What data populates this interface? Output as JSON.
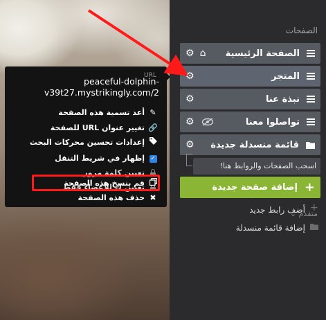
{
  "section_title": "الصفحات",
  "pages": [
    {
      "label": "الصفحة الرئيسية",
      "home": true,
      "hidden": false
    },
    {
      "label": "المتجر",
      "home": false,
      "hidden": false,
      "active": true
    },
    {
      "label": "نبذة عنا",
      "home": false,
      "hidden": false
    },
    {
      "label": "تواصلوا معنا",
      "home": false,
      "hidden": true
    },
    {
      "label": "قائمة منسدلة جديدة",
      "home": false,
      "folder": true
    }
  ],
  "drag_tip": "اسحب الصفحات والروابط هنا!",
  "add_page_button": "إضافة صفحة جديدة",
  "advanced_label": "متقدم",
  "advanced_items": [
    "أضف رابط جديد",
    "إضافة قائمة منسدلة"
  ],
  "menu": {
    "url_label": "URL",
    "url_line1": "peaceful-dolphin-",
    "url_line2": "v39t27.mystrikingly.com/2",
    "items": [
      {
        "label": "أعد تسمية هذه الصفحة",
        "icon": "pencil-icon"
      },
      {
        "label": "تغيير عنوان URL للصفحة",
        "icon": "link-icon"
      },
      {
        "label": "إعدادات تحسين محركات البحث",
        "icon": "tag-icon"
      },
      {
        "label": "إظهار في شريط التنقل",
        "icon": "checkbox-icon",
        "checked": true
      },
      {
        "label": "تعيين كلمة مرور",
        "icon": "lock-icon"
      },
      {
        "label": "تعيين ك للأعضاء فقط",
        "icon": "lock-icon"
      },
      {
        "label": "قم بنسخ هذه الصفحة",
        "icon": "copy-icon"
      },
      {
        "label": "حذف هذه الصفحة",
        "icon": "x-icon"
      }
    ]
  },
  "colors": {
    "accent_green": "#8bb534",
    "highlight_red": "#ff1a1a",
    "checkbox_blue": "#2f83e6"
  }
}
